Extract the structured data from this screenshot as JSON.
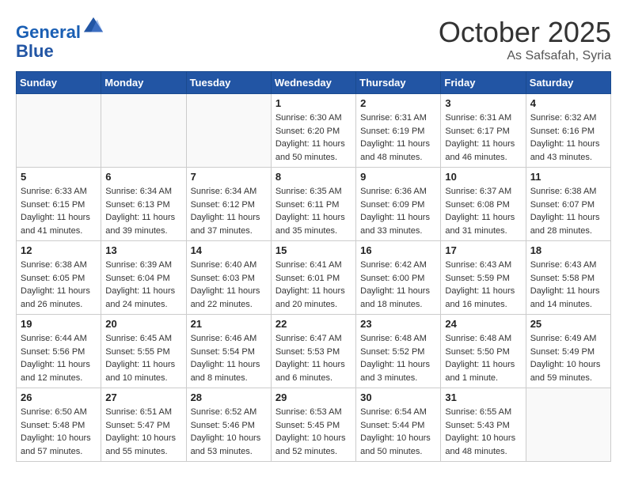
{
  "header": {
    "logo_line1": "General",
    "logo_line2": "Blue",
    "month": "October 2025",
    "location": "As Safsafah, Syria"
  },
  "days_of_week": [
    "Sunday",
    "Monday",
    "Tuesday",
    "Wednesday",
    "Thursday",
    "Friday",
    "Saturday"
  ],
  "weeks": [
    [
      {
        "day": "",
        "info": ""
      },
      {
        "day": "",
        "info": ""
      },
      {
        "day": "",
        "info": ""
      },
      {
        "day": "1",
        "info": "Sunrise: 6:30 AM\nSunset: 6:20 PM\nDaylight: 11 hours\nand 50 minutes."
      },
      {
        "day": "2",
        "info": "Sunrise: 6:31 AM\nSunset: 6:19 PM\nDaylight: 11 hours\nand 48 minutes."
      },
      {
        "day": "3",
        "info": "Sunrise: 6:31 AM\nSunset: 6:17 PM\nDaylight: 11 hours\nand 46 minutes."
      },
      {
        "day": "4",
        "info": "Sunrise: 6:32 AM\nSunset: 6:16 PM\nDaylight: 11 hours\nand 43 minutes."
      }
    ],
    [
      {
        "day": "5",
        "info": "Sunrise: 6:33 AM\nSunset: 6:15 PM\nDaylight: 11 hours\nand 41 minutes."
      },
      {
        "day": "6",
        "info": "Sunrise: 6:34 AM\nSunset: 6:13 PM\nDaylight: 11 hours\nand 39 minutes."
      },
      {
        "day": "7",
        "info": "Sunrise: 6:34 AM\nSunset: 6:12 PM\nDaylight: 11 hours\nand 37 minutes."
      },
      {
        "day": "8",
        "info": "Sunrise: 6:35 AM\nSunset: 6:11 PM\nDaylight: 11 hours\nand 35 minutes."
      },
      {
        "day": "9",
        "info": "Sunrise: 6:36 AM\nSunset: 6:09 PM\nDaylight: 11 hours\nand 33 minutes."
      },
      {
        "day": "10",
        "info": "Sunrise: 6:37 AM\nSunset: 6:08 PM\nDaylight: 11 hours\nand 31 minutes."
      },
      {
        "day": "11",
        "info": "Sunrise: 6:38 AM\nSunset: 6:07 PM\nDaylight: 11 hours\nand 28 minutes."
      }
    ],
    [
      {
        "day": "12",
        "info": "Sunrise: 6:38 AM\nSunset: 6:05 PM\nDaylight: 11 hours\nand 26 minutes."
      },
      {
        "day": "13",
        "info": "Sunrise: 6:39 AM\nSunset: 6:04 PM\nDaylight: 11 hours\nand 24 minutes."
      },
      {
        "day": "14",
        "info": "Sunrise: 6:40 AM\nSunset: 6:03 PM\nDaylight: 11 hours\nand 22 minutes."
      },
      {
        "day": "15",
        "info": "Sunrise: 6:41 AM\nSunset: 6:01 PM\nDaylight: 11 hours\nand 20 minutes."
      },
      {
        "day": "16",
        "info": "Sunrise: 6:42 AM\nSunset: 6:00 PM\nDaylight: 11 hours\nand 18 minutes."
      },
      {
        "day": "17",
        "info": "Sunrise: 6:43 AM\nSunset: 5:59 PM\nDaylight: 11 hours\nand 16 minutes."
      },
      {
        "day": "18",
        "info": "Sunrise: 6:43 AM\nSunset: 5:58 PM\nDaylight: 11 hours\nand 14 minutes."
      }
    ],
    [
      {
        "day": "19",
        "info": "Sunrise: 6:44 AM\nSunset: 5:56 PM\nDaylight: 11 hours\nand 12 minutes."
      },
      {
        "day": "20",
        "info": "Sunrise: 6:45 AM\nSunset: 5:55 PM\nDaylight: 11 hours\nand 10 minutes."
      },
      {
        "day": "21",
        "info": "Sunrise: 6:46 AM\nSunset: 5:54 PM\nDaylight: 11 hours\nand 8 minutes."
      },
      {
        "day": "22",
        "info": "Sunrise: 6:47 AM\nSunset: 5:53 PM\nDaylight: 11 hours\nand 6 minutes."
      },
      {
        "day": "23",
        "info": "Sunrise: 6:48 AM\nSunset: 5:52 PM\nDaylight: 11 hours\nand 3 minutes."
      },
      {
        "day": "24",
        "info": "Sunrise: 6:48 AM\nSunset: 5:50 PM\nDaylight: 11 hours\nand 1 minute."
      },
      {
        "day": "25",
        "info": "Sunrise: 6:49 AM\nSunset: 5:49 PM\nDaylight: 10 hours\nand 59 minutes."
      }
    ],
    [
      {
        "day": "26",
        "info": "Sunrise: 6:50 AM\nSunset: 5:48 PM\nDaylight: 10 hours\nand 57 minutes."
      },
      {
        "day": "27",
        "info": "Sunrise: 6:51 AM\nSunset: 5:47 PM\nDaylight: 10 hours\nand 55 minutes."
      },
      {
        "day": "28",
        "info": "Sunrise: 6:52 AM\nSunset: 5:46 PM\nDaylight: 10 hours\nand 53 minutes."
      },
      {
        "day": "29",
        "info": "Sunrise: 6:53 AM\nSunset: 5:45 PM\nDaylight: 10 hours\nand 52 minutes."
      },
      {
        "day": "30",
        "info": "Sunrise: 6:54 AM\nSunset: 5:44 PM\nDaylight: 10 hours\nand 50 minutes."
      },
      {
        "day": "31",
        "info": "Sunrise: 6:55 AM\nSunset: 5:43 PM\nDaylight: 10 hours\nand 48 minutes."
      },
      {
        "day": "",
        "info": ""
      }
    ]
  ]
}
